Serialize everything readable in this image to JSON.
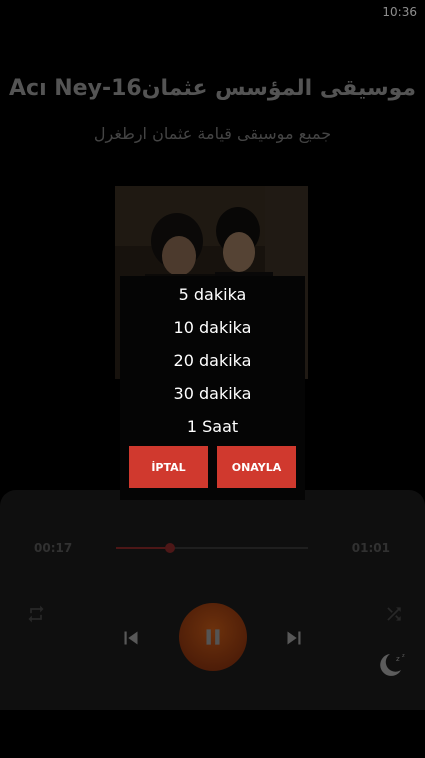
{
  "status_bar": {
    "time": "10:36"
  },
  "song": {
    "title": "Acı Ney-16موسيقى المؤسس عثمان",
    "subtitle": "جميع موسيقى قيامة عثمان ارطغرل"
  },
  "player": {
    "current_time": "00:17",
    "total_time": "01:01",
    "progress": 0.28
  },
  "sleep_dialog": {
    "options": [
      "5 dakika",
      "10 dakika",
      "20 dakika",
      "30 dakika",
      "1 Saat"
    ],
    "cancel_label": "İPTAL",
    "confirm_label": "ONAYLA"
  },
  "colors": {
    "accent": "#d0392e",
    "play_button": "#c55a17",
    "seek_progress": "#8c2a2a"
  },
  "icons": [
    "repeat-icon",
    "skip-previous-icon",
    "pause-icon",
    "skip-next-icon",
    "shuffle-icon",
    "sleep-timer-icon"
  ]
}
